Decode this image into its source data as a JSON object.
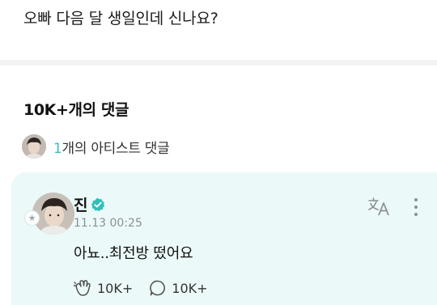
{
  "post": {
    "text": "오빠 다음 달 생일인데 신나요?"
  },
  "comments_section": {
    "count_label": "10K+개의 댓글",
    "artist_comments": {
      "count": "1",
      "label": "개의 아티스트 댓글"
    }
  },
  "artist_comment": {
    "author": "진",
    "verified_icon": "verified-check-icon",
    "timestamp": "11.13 00:25",
    "body": "아뇨..최전방 떴어요",
    "likes": "10K+",
    "replies": "10K+",
    "translate_icon": "translate-icon",
    "more_icon": "more-vertical-icon"
  },
  "colors": {
    "accent": "#2fc1b8",
    "card_background": "#ebfaf8",
    "muted_text": "#8e8e93"
  }
}
